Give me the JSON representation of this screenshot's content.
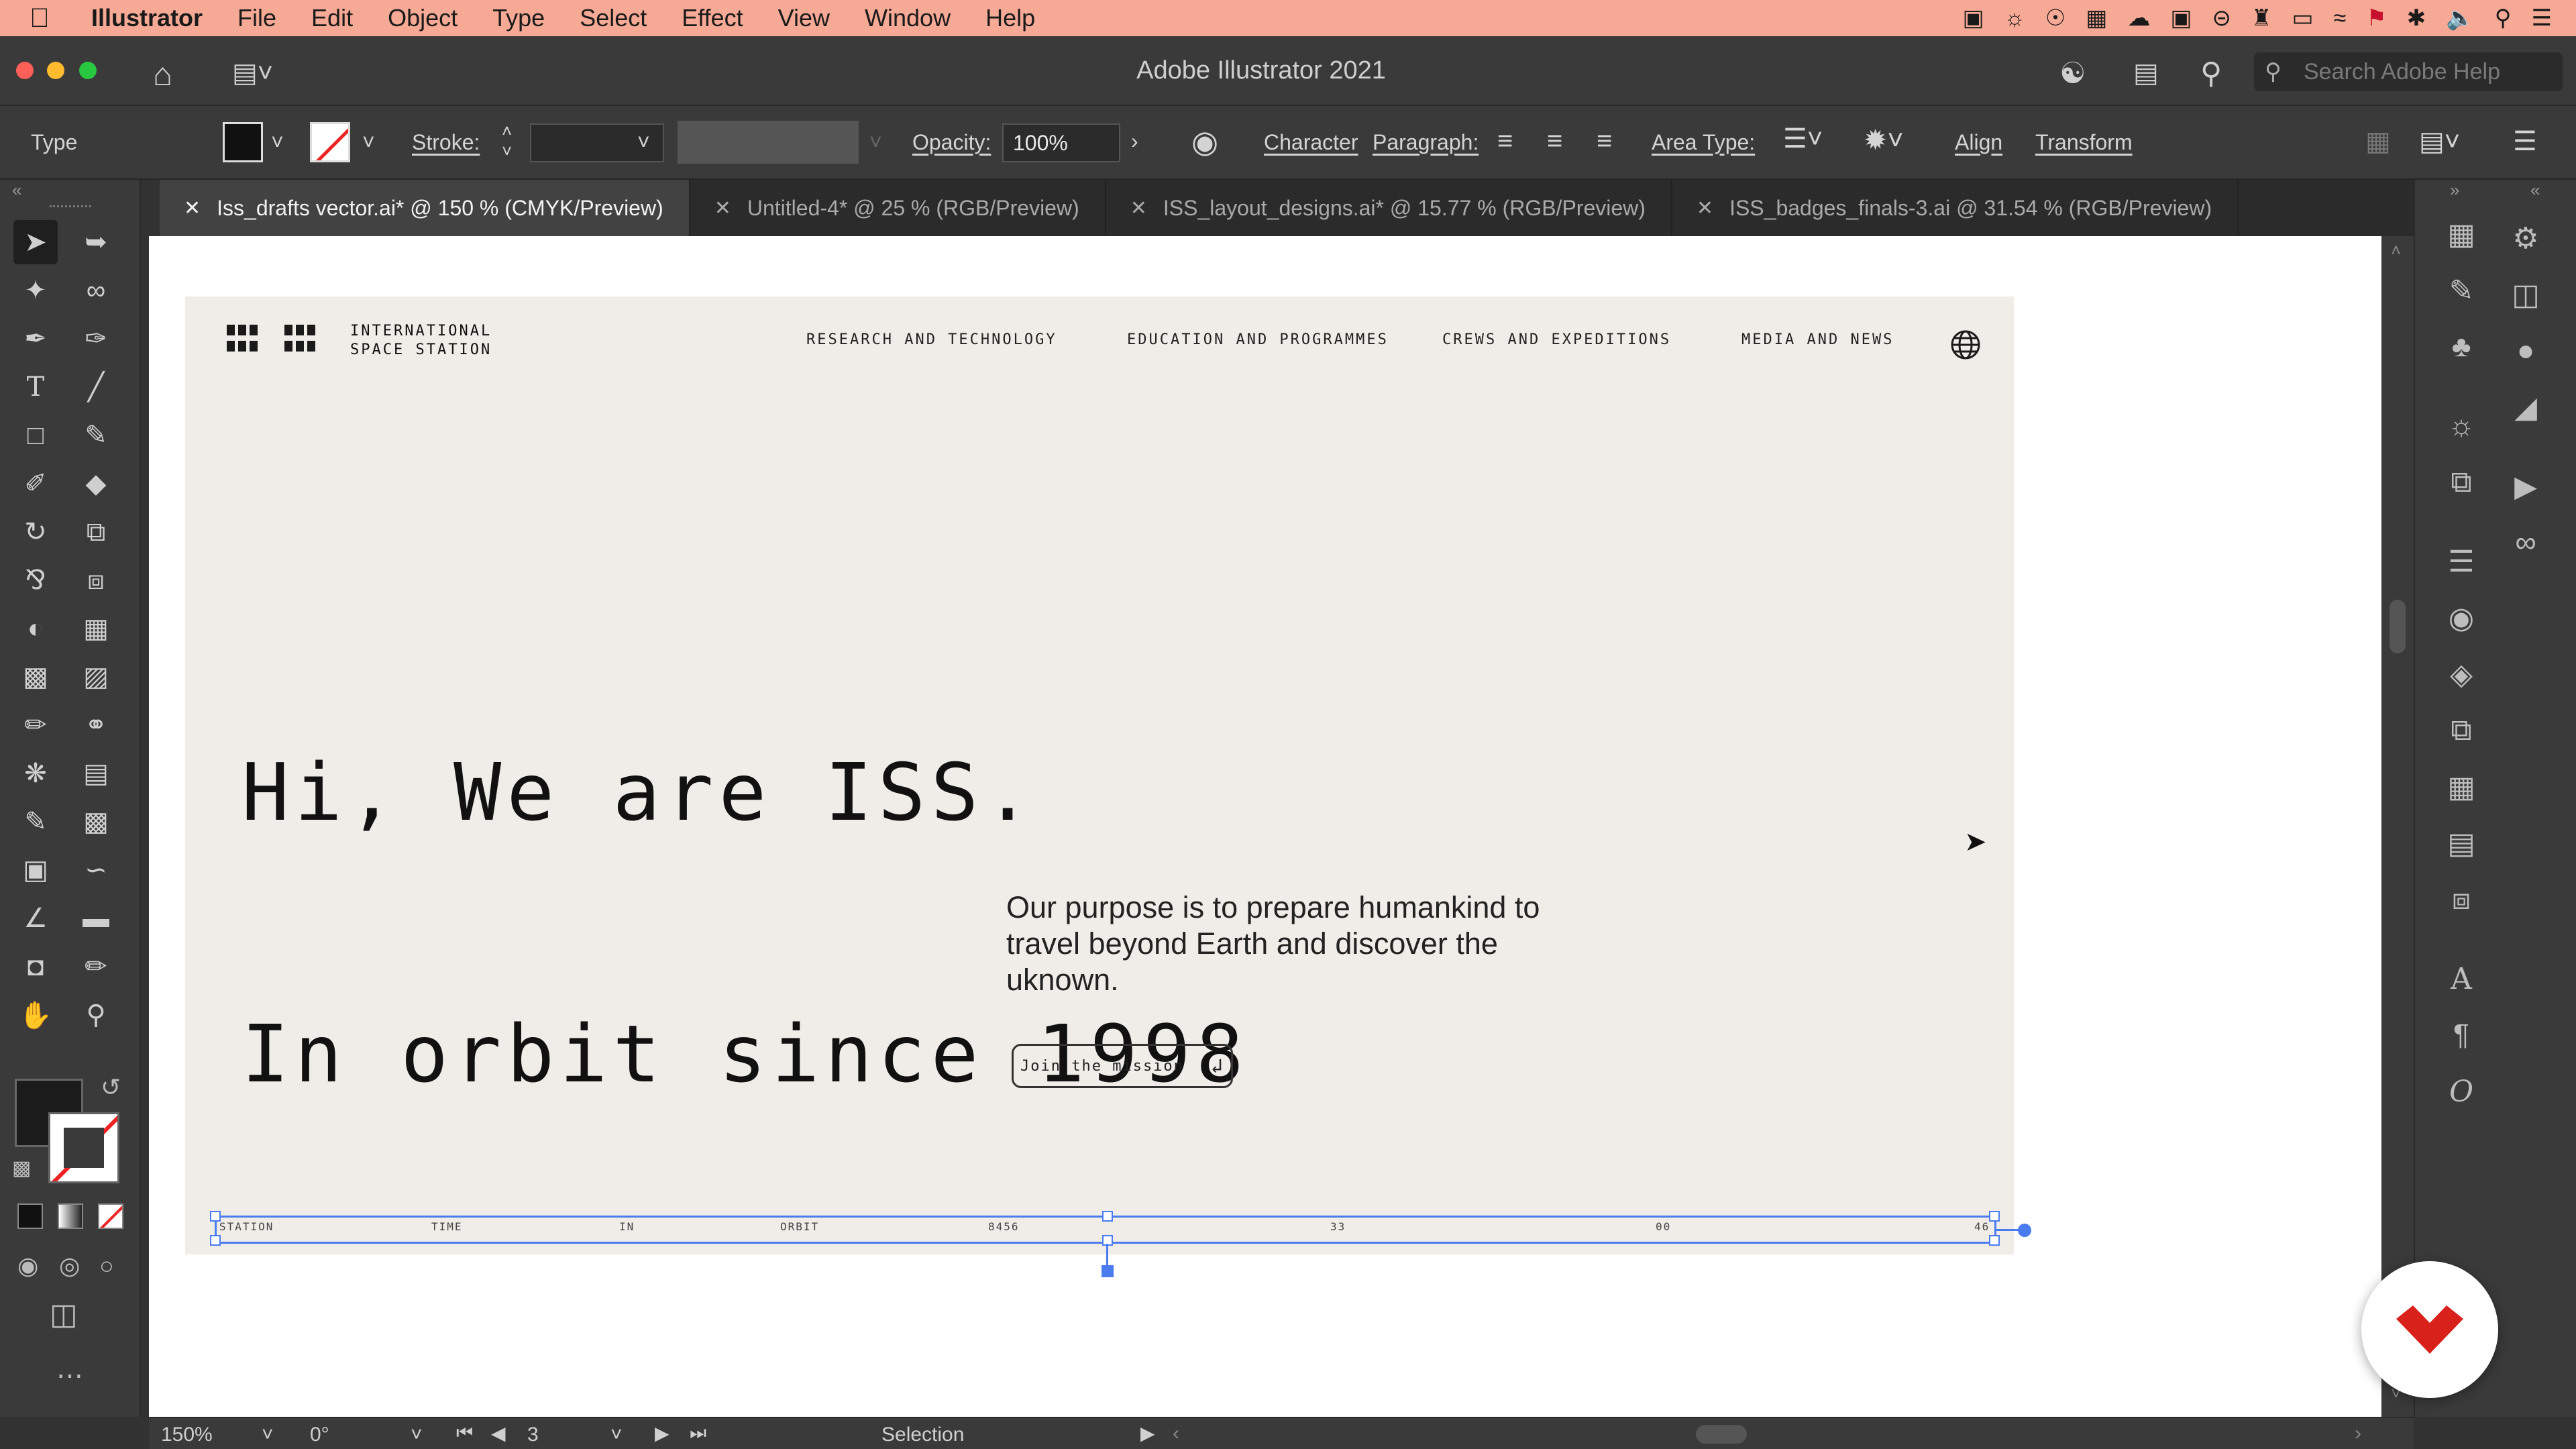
{
  "menubar": {
    "app_name": "Illustrator",
    "items": [
      "File",
      "Edit",
      "Object",
      "Type",
      "Select",
      "Effect",
      "View",
      "Window",
      "Help"
    ]
  },
  "window": {
    "title": "Adobe Illustrator 2021",
    "search_placeholder": "Search Adobe Help"
  },
  "control_bar": {
    "selection_type": "Type",
    "stroke_label": "Stroke:",
    "opacity_label": "Opacity:",
    "opacity_value": "100%",
    "character_label": "Character",
    "paragraph_label": "Paragraph:",
    "area_type_label": "Area Type:",
    "align_label": "Align",
    "transform_label": "Transform"
  },
  "tabs": [
    {
      "label": "Iss_drafts vector.ai* @ 150 % (CMYK/Preview)",
      "active": true
    },
    {
      "label": "Untitled-4* @ 25 % (RGB/Preview)",
      "active": false
    },
    {
      "label": "ISS_layout_designs.ai* @ 15.77 % (RGB/Preview)",
      "active": false
    },
    {
      "label": "ISS_badges_finals-3.ai @ 31.54 % (RGB/Preview)",
      "active": false
    }
  ],
  "artboard": {
    "logo_line1": "INTERNATIONAL",
    "logo_line2": "SPACE STATION",
    "nav": [
      "RESEARCH AND TECHNOLOGY",
      "EDUCATION AND PROGRAMMES",
      "CREWS AND EXPEDITIONS",
      "MEDIA AND NEWS"
    ],
    "hero_line1": "Hi, We are ISS.",
    "hero_line2": "In orbit since 1998",
    "purpose": "Our purpose is to prepare humankind to travel beyond Earth and discover the uknown.",
    "cta": "Join the mission",
    "cta_icon": "return-arrow-icon",
    "stats_row": [
      "STATION",
      "TIME",
      "IN",
      "ORBIT",
      "8456",
      "33",
      "00",
      "46"
    ]
  },
  "status_bar": {
    "zoom": "150%",
    "rotation": "0°",
    "artboard_number": "3",
    "tool": "Selection"
  },
  "colors": {
    "menubar": "#f6a995",
    "selection": "#4a7cf0",
    "artboard_bg": "#f0ece8",
    "badge_red": "#d9211c"
  }
}
